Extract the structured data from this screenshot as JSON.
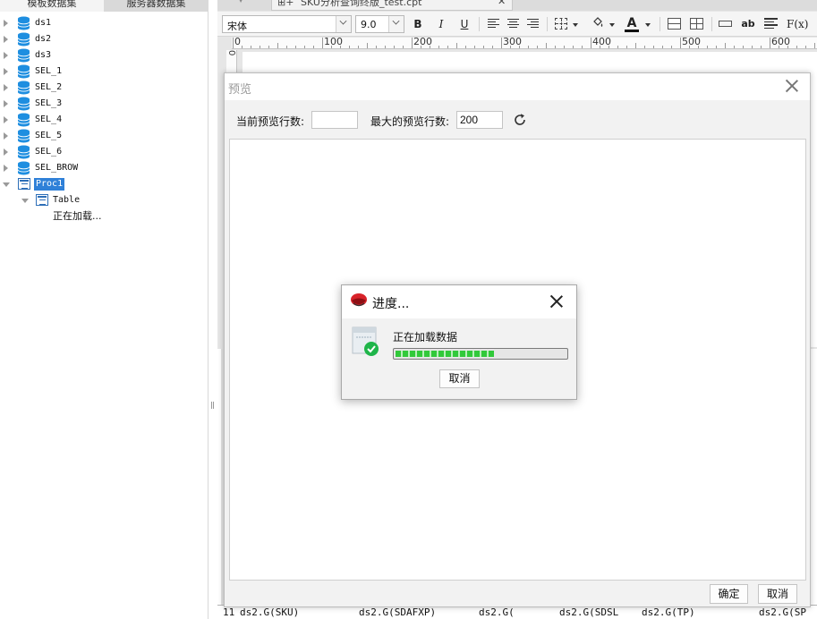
{
  "left_panel": {
    "tabs": [
      "模板数据集",
      "服务器数据集"
    ],
    "datasets": [
      "ds1",
      "ds2",
      "ds3",
      "SEL_1",
      "SEL_2",
      "SEL_3",
      "SEL_4",
      "SEL_5",
      "SEL_6",
      "SEL_BROW"
    ],
    "proc_node": "Proc1",
    "table_node": "Table",
    "loading_text": "正在加载..."
  },
  "editor": {
    "doc_tab_label": "SKU分析查询终版_test.cpt",
    "toolbar": {
      "font_name": "宋体",
      "font_size": "9.0",
      "bold": "B",
      "italic": "I",
      "underline": "U",
      "text_fit": "ab",
      "formula": "F(x)"
    },
    "ruler_labels": [
      "0",
      "100",
      "200",
      "300",
      "400",
      "500",
      "600"
    ],
    "ruler_v_label": "0",
    "bottom_row_number": "11",
    "bottom_cells": [
      "ds2.G(SKU)",
      "ds2.G(SDAFXP)",
      "ds2.G(",
      "ds2.G(SDSL",
      "ds2.G(TP)",
      "ds2.G(SP"
    ]
  },
  "preview_dialog": {
    "title": "预览",
    "current_rows_label": "当前预览行数:",
    "current_rows_value": "",
    "max_rows_label": "最大的预览行数:",
    "max_rows_value": "200",
    "ok_label": "确定",
    "cancel_label": "取消"
  },
  "progress_dialog": {
    "title": "进度...",
    "message": "正在加载数据",
    "progress_fraction": 0.58,
    "cancel_label": "取消"
  },
  "colors": {
    "selection_blue": "#2f80d8",
    "database_blue": "#1e8ee0",
    "progress_green": "#31c93a",
    "logo_red": "#d8232a",
    "check_green": "#1fb54a"
  }
}
